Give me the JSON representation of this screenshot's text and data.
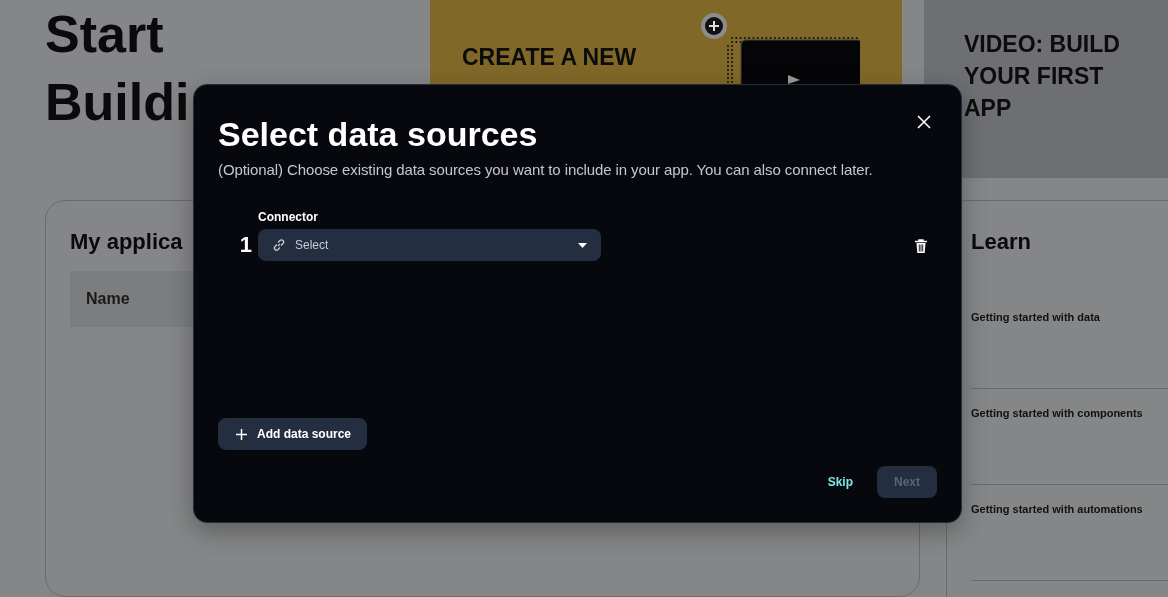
{
  "page": {
    "heading_lines": [
      "Start",
      "Buildi"
    ],
    "create_card": {
      "title": "CREATE A NEW"
    },
    "video_card": {
      "title": "VIDEO: BUILD YOUR FIRST APP"
    },
    "applications": {
      "title": "My applica",
      "columns": [
        "Name"
      ]
    },
    "learn": {
      "title": "Learn",
      "items": [
        "Getting started with data",
        "Getting started with components",
        "Getting started with automations"
      ]
    }
  },
  "dialog": {
    "title": "Select data sources",
    "subtitle": "(Optional) Choose existing data sources you want to include in your app. You can also connect later.",
    "data_sources": [
      {
        "number": "1",
        "label": "Connector",
        "placeholder": "Select"
      }
    ],
    "add_button": "Add data source",
    "skip": "Skip",
    "next": {
      "label": "Next",
      "disabled": true
    }
  }
}
